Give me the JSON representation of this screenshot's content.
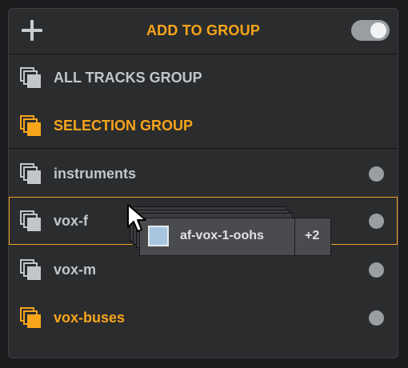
{
  "header": {
    "add_icon": "plus-icon",
    "title": "ADD TO GROUP",
    "toggle_on": true
  },
  "groups": [
    {
      "label": "ALL TRACKS GROUP",
      "icon": "stacked-squares-icon",
      "color": "#c2c6ca",
      "has_dot": false
    },
    {
      "label": "SELECTION GROUP",
      "icon": "stacked-squares-icon",
      "color": "#f7a51b",
      "has_dot": false
    },
    {
      "label": "instruments",
      "icon": "stacked-squares-icon",
      "color": "#c2c6ca",
      "has_dot": true
    },
    {
      "label": "vox-f",
      "icon": "stacked-squares-icon",
      "color": "#c2c6ca",
      "has_dot": true,
      "selected": true
    },
    {
      "label": "vox-m",
      "icon": "stacked-squares-icon",
      "color": "#c2c6ca",
      "has_dot": true
    },
    {
      "label": "vox-buses",
      "icon": "stacked-squares-icon",
      "color": "#f7a51b",
      "has_dot": true
    }
  ],
  "drag": {
    "track_name": "af-vox-1-oohs",
    "extra_count": "+2",
    "swatch_color": "#a9c6e0"
  },
  "colors": {
    "accent": "#f7a51b",
    "panel": "#2b2c2e",
    "text": "#c2c6ca"
  }
}
